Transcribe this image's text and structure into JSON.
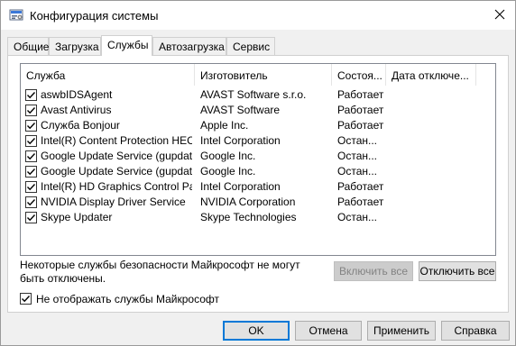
{
  "window": {
    "title": "Конфигурация системы"
  },
  "tabs": [
    {
      "label": "Общие"
    },
    {
      "label": "Загрузка"
    },
    {
      "label": "Службы"
    },
    {
      "label": "Автозагрузка"
    },
    {
      "label": "Сервис"
    }
  ],
  "active_tab": "Службы",
  "columns": {
    "service": "Служба",
    "manufacturer": "Изготовитель",
    "status": "Состоя...",
    "disabled_date": "Дата отключе..."
  },
  "services": [
    {
      "name": "aswbIDSAgent",
      "manufacturer": "AVAST Software s.r.o.",
      "status": "Работает",
      "checked": true
    },
    {
      "name": "Avast Antivirus",
      "manufacturer": "AVAST Software",
      "status": "Работает",
      "checked": true
    },
    {
      "name": "Служба Bonjour",
      "manufacturer": "Apple Inc.",
      "status": "Работает",
      "checked": true
    },
    {
      "name": "Intel(R) Content Protection HEC...",
      "manufacturer": "Intel Corporation",
      "status": "Остан...",
      "checked": true
    },
    {
      "name": "Google Update Service (gupdate)",
      "manufacturer": "Google Inc.",
      "status": "Остан...",
      "checked": true
    },
    {
      "name": "Google Update Service (gupdatem)",
      "manufacturer": "Google Inc.",
      "status": "Остан...",
      "checked": true
    },
    {
      "name": "Intel(R) HD Graphics Control Pa...",
      "manufacturer": "Intel Corporation",
      "status": "Работает",
      "checked": true
    },
    {
      "name": "NVIDIA Display Driver Service",
      "manufacturer": "NVIDIA Corporation",
      "status": "Работает",
      "checked": true
    },
    {
      "name": "Skype Updater",
      "manufacturer": "Skype Technologies",
      "status": "Остан...",
      "checked": true
    }
  ],
  "notice": "Некоторые службы безопасности Майкрософт не могут быть отключены.",
  "buttons": {
    "enable_all": "Включить все",
    "disable_all": "Отключить все",
    "ok": "OK",
    "cancel": "Отмена",
    "apply": "Применить",
    "help": "Справка"
  },
  "hide_ms": {
    "label": "Не отображать службы Майкрософт",
    "checked": true
  },
  "colors": {
    "accent": "#0078d7",
    "panel": "#ffffff",
    "window_bg": "#f0f0f0"
  }
}
